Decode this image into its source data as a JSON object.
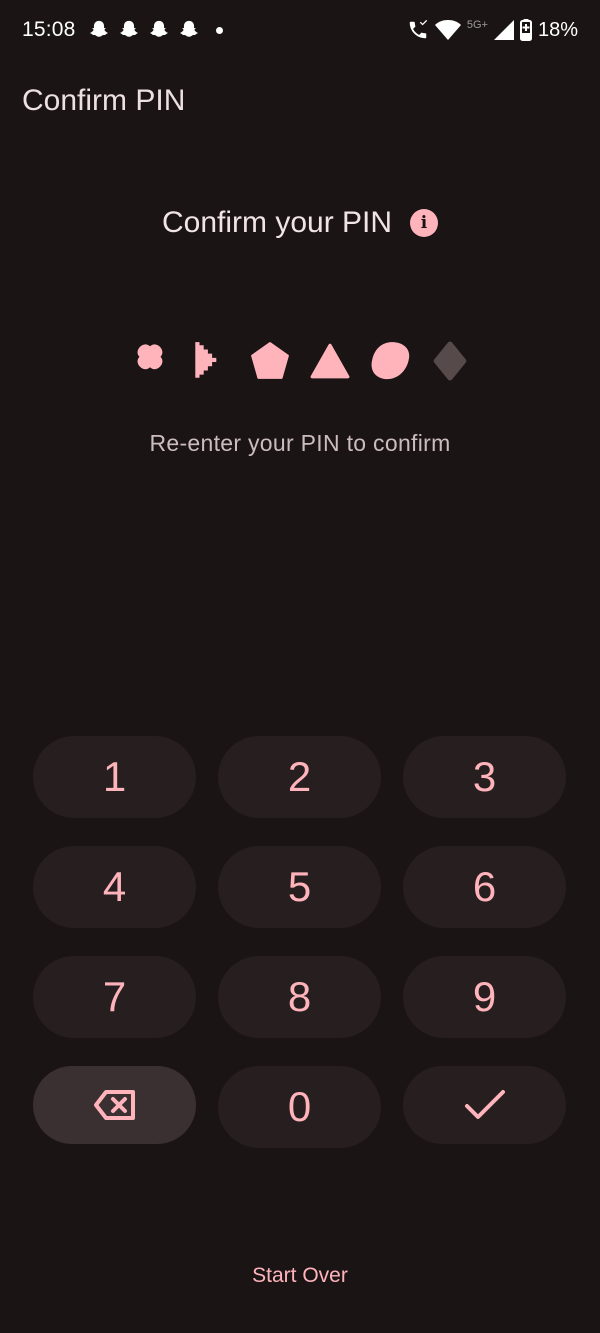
{
  "status_bar": {
    "time": "15:08",
    "notification_icons": [
      "snapchat-icon",
      "snapchat-icon",
      "snapchat-icon",
      "snapchat-icon"
    ],
    "network_label": "5G+",
    "battery_percent": "18%"
  },
  "app_bar": {
    "title": "Confirm PIN"
  },
  "main": {
    "heading": "Confirm your PIN",
    "info_icon_glyph": "i",
    "subtitle": "Re-enter your PIN to confirm",
    "pin_shapes": [
      {
        "shape": "flower",
        "filled": true
      },
      {
        "shape": "staircase-arrow",
        "filled": true
      },
      {
        "shape": "pentagon",
        "filled": true
      },
      {
        "shape": "triangle",
        "filled": true
      },
      {
        "shape": "blob",
        "filled": true
      },
      {
        "shape": "hexagon",
        "filled": false
      }
    ]
  },
  "keypad": {
    "keys": [
      "1",
      "2",
      "3",
      "4",
      "5",
      "6",
      "7",
      "8",
      "9"
    ],
    "zero": "0",
    "backspace_icon": "backspace-icon",
    "confirm_icon": "check-icon"
  },
  "footer": {
    "start_over": "Start Over"
  },
  "colors": {
    "background": "#1b1415",
    "accent": "#ffb4bc",
    "key_bg": "#261e1f",
    "key_bg_active": "#3a3031",
    "pin_empty": "#574a4b"
  }
}
